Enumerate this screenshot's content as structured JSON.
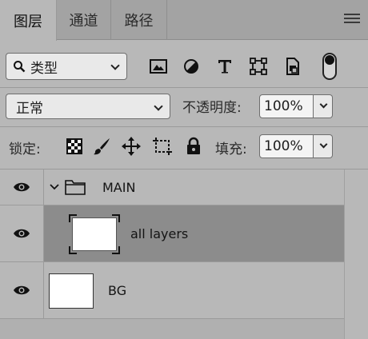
{
  "tabs": [
    {
      "label": "图层",
      "active": true
    },
    {
      "label": "通道",
      "active": false
    },
    {
      "label": "路径",
      "active": false
    }
  ],
  "filter": {
    "kind_label": "类型",
    "icons": [
      "image-filter-icon",
      "adjustment-filter-icon",
      "type-filter-icon",
      "shape-filter-icon",
      "smart-object-filter-icon"
    ],
    "toggle_on": true
  },
  "blend": {
    "mode": "正常",
    "opacity_label": "不透明度:",
    "opacity_value": "100%"
  },
  "lock": {
    "label": "锁定:",
    "icons": [
      "lock-transparent-pixels-icon",
      "lock-image-pixels-icon",
      "lock-position-icon",
      "prevent-autonest-icon",
      "lock-all-icon"
    ],
    "fill_label": "填充:",
    "fill_value": "100%"
  },
  "layers": [
    {
      "name": "MAIN",
      "type": "group",
      "visible": true,
      "expanded": true
    },
    {
      "name": "all layers",
      "type": "smart",
      "visible": true,
      "selected": true
    },
    {
      "name": "BG",
      "type": "pixel",
      "visible": true
    }
  ]
}
